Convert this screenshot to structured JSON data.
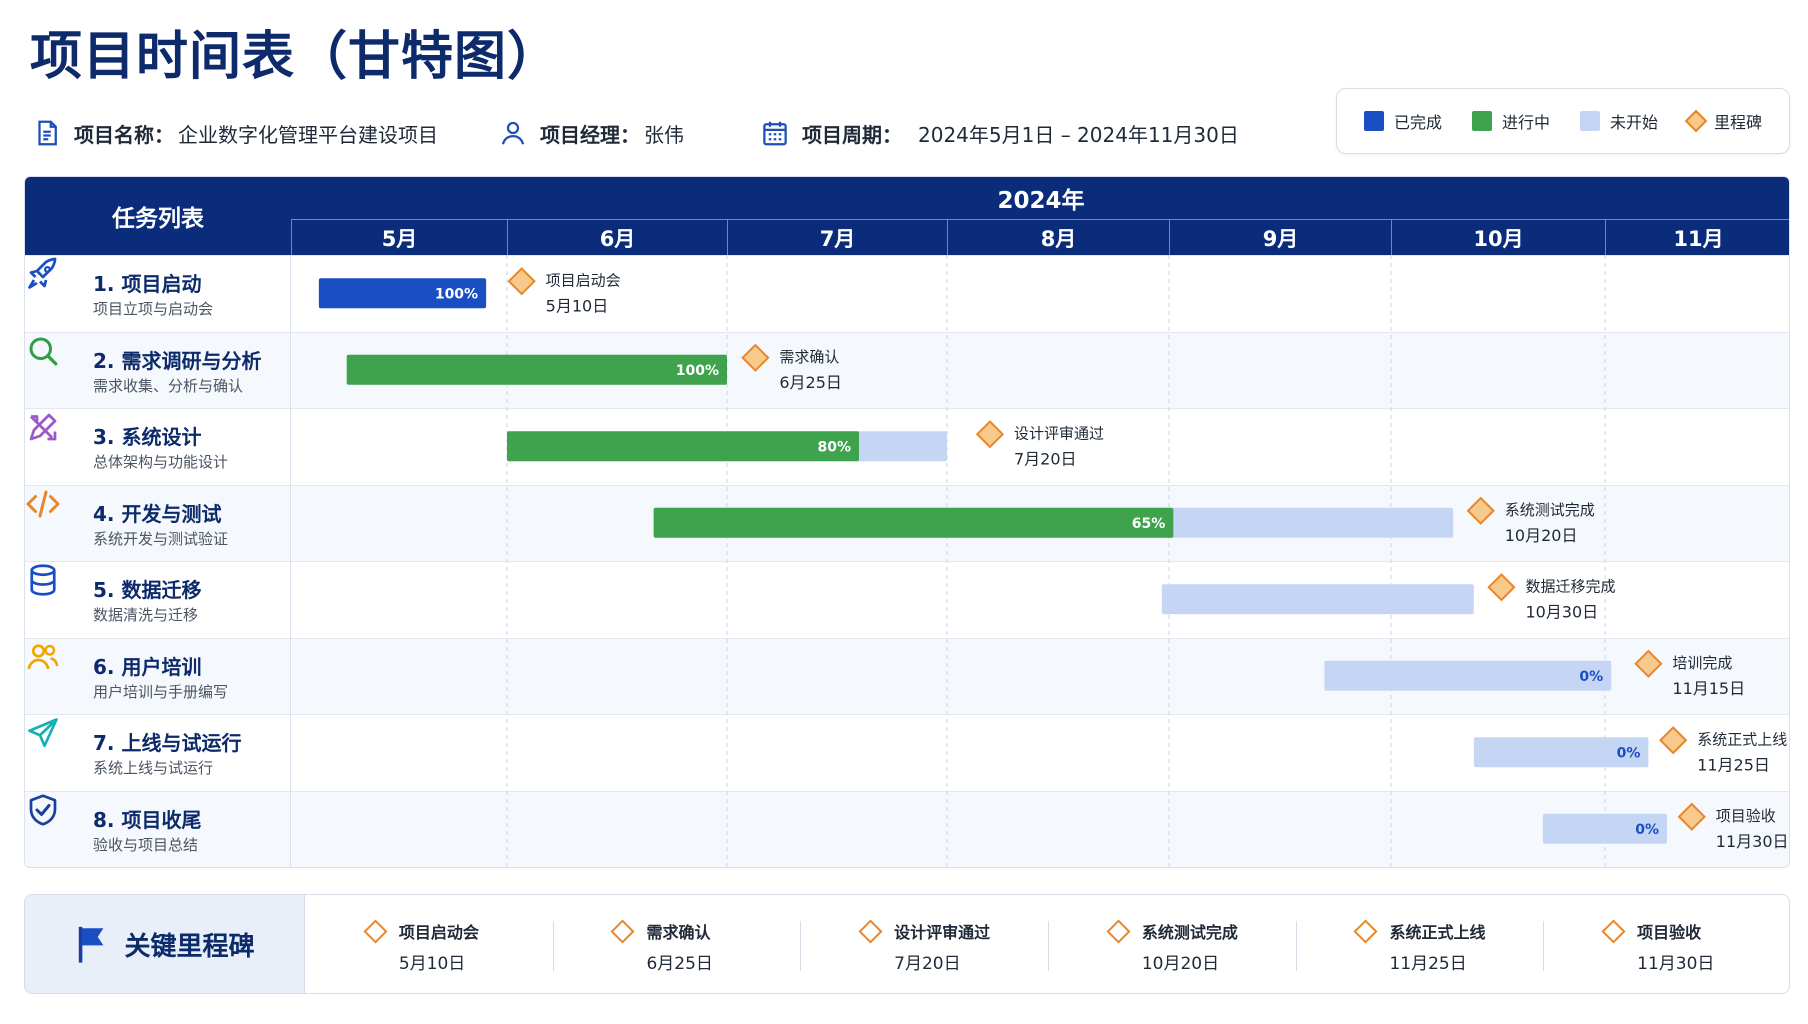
{
  "title": "项目时间表（甘特图）",
  "info": {
    "name_label": "项目名称：",
    "name_value": "企业数字化管理平台建设项目",
    "manager_label": "项目经理：",
    "manager_value": "张伟",
    "period_label": "项目周期：",
    "period_value": "2024年5月1日 – 2024年11月30日"
  },
  "legend": {
    "done": "已完成",
    "inprogress": "进行中",
    "notstarted": "未开始",
    "milestone": "里程碑",
    "colors": {
      "done": "#1a4fc4",
      "inprogress": "#3fa34d",
      "notstarted": "#c5d6f5",
      "milestone": "#e8862a"
    }
  },
  "chart_data": {
    "type": "gantt",
    "task_header": "任务列表",
    "year": "2024年",
    "months": [
      "5月",
      "6月",
      "7月",
      "8月",
      "9月",
      "10月",
      "11月"
    ],
    "tasks": [
      {
        "name": "1. 项目启动",
        "desc": "项目立项与启动会",
        "start": "2024-05-05",
        "end": "2024-05-29",
        "progress": 100,
        "progress_label": "100%",
        "status": "done",
        "milestone": "项目启动会",
        "milestone_date": "5月10日",
        "milestone_at": "2024-06-03",
        "icon": "rocket-icon"
      },
      {
        "name": "2. 需求调研与分析",
        "desc": "需求收集、分析与确认",
        "start": "2024-05-09",
        "end": "2024-07-01",
        "progress": 100,
        "progress_label": "100%",
        "status": "inprogress",
        "milestone": "需求确认",
        "milestone_date": "6月25日",
        "milestone_at": "2024-07-05",
        "icon": "search-icon"
      },
      {
        "name": "3. 系统设计",
        "desc": "总体架构与功能设计",
        "start": "2024-06-01",
        "end": "2024-08-01",
        "progress": 80,
        "progress_label": "80%",
        "status": "inprogress",
        "milestone": "设计评审通过",
        "milestone_date": "7月20日",
        "milestone_at": "2024-08-07",
        "icon": "design-icon"
      },
      {
        "name": "4. 开发与测试",
        "desc": "系统开发与测试验证",
        "start": "2024-06-21",
        "end": "2024-10-10",
        "progress": 65,
        "progress_label": "65%",
        "status": "inprogress",
        "milestone": "系统测试完成",
        "milestone_date": "10月20日",
        "milestone_at": "2024-10-14",
        "icon": "code-icon"
      },
      {
        "name": "5. 数据迁移",
        "desc": "数据清洗与迁移",
        "start": "2024-08-31",
        "end": "2024-10-13",
        "progress": 0,
        "progress_label": "",
        "status": "notstarted",
        "milestone": "数据迁移完成",
        "milestone_date": "10月30日",
        "milestone_at": "2024-10-17",
        "icon": "database-icon"
      },
      {
        "name": "6. 用户培训",
        "desc": "用户培训与手册编写",
        "start": "2024-09-22",
        "end": "2024-11-02",
        "progress": 0,
        "progress_label": "0%",
        "status": "notstarted",
        "milestone": "培训完成",
        "milestone_date": "11月15日",
        "milestone_at": "2024-11-08",
        "icon": "users-icon"
      },
      {
        "name": "7. 上线与试运行",
        "desc": "系统上线与试运行",
        "start": "2024-10-13",
        "end": "2024-11-08",
        "progress": 0,
        "progress_label": "0%",
        "status": "notstarted",
        "milestone": "系统正式上线",
        "milestone_date": "11月25日",
        "milestone_at": "2024-11-12",
        "icon": "send-icon"
      },
      {
        "name": "8. 项目收尾",
        "desc": "验收与项目总结",
        "start": "2024-10-23",
        "end": "2024-11-11",
        "progress": 0,
        "progress_label": "0%",
        "status": "notstarted",
        "milestone": "项目验收",
        "milestone_date": "11月30日",
        "milestone_at": "2024-11-15",
        "icon": "shield-check-icon"
      }
    ]
  },
  "key_milestones": {
    "title": "关键里程碑",
    "items": [
      {
        "name": "项目启动会",
        "date": "5月10日"
      },
      {
        "name": "需求确认",
        "date": "6月25日"
      },
      {
        "name": "设计评审通过",
        "date": "7月20日"
      },
      {
        "name": "系统测试完成",
        "date": "10月20日"
      },
      {
        "name": "系统正式上线",
        "date": "11月25日"
      },
      {
        "name": "项目验收",
        "date": "11月30日"
      }
    ]
  }
}
